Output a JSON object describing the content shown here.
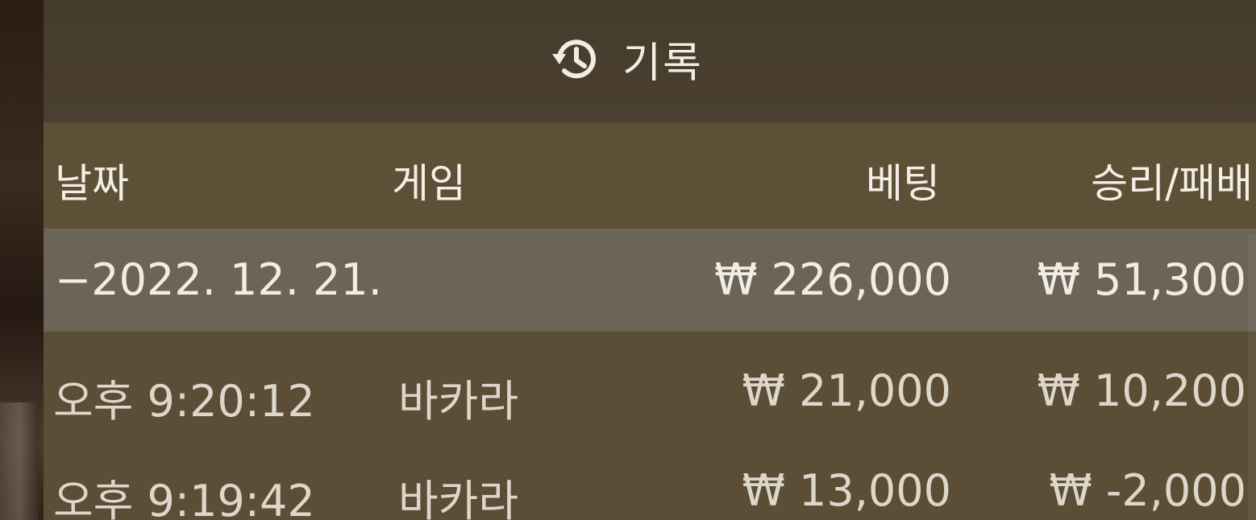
{
  "header": {
    "title": "기록",
    "icon": "history-icon"
  },
  "columns": {
    "date": "날짜",
    "game": "게임",
    "bet": "베팅",
    "win_loss": "승리/패배"
  },
  "summary": {
    "date": "−2022. 12. 21.",
    "bet": "₩ 226,000",
    "win_loss": "₩ 51,300"
  },
  "rows": [
    {
      "time": "오후 9:20:12",
      "game": "바카라",
      "bet": "₩ 21,000",
      "win_loss": "₩ 10,200"
    },
    {
      "time": "오후 9:19:42",
      "game": "바카라",
      "bet": "₩ 13,000",
      "win_loss": "₩ -2,000"
    }
  ],
  "colors": {
    "panel": "#5b4d36",
    "header": "#463c2c",
    "summary_row": "#6b6457",
    "text": "#f2ede4"
  }
}
